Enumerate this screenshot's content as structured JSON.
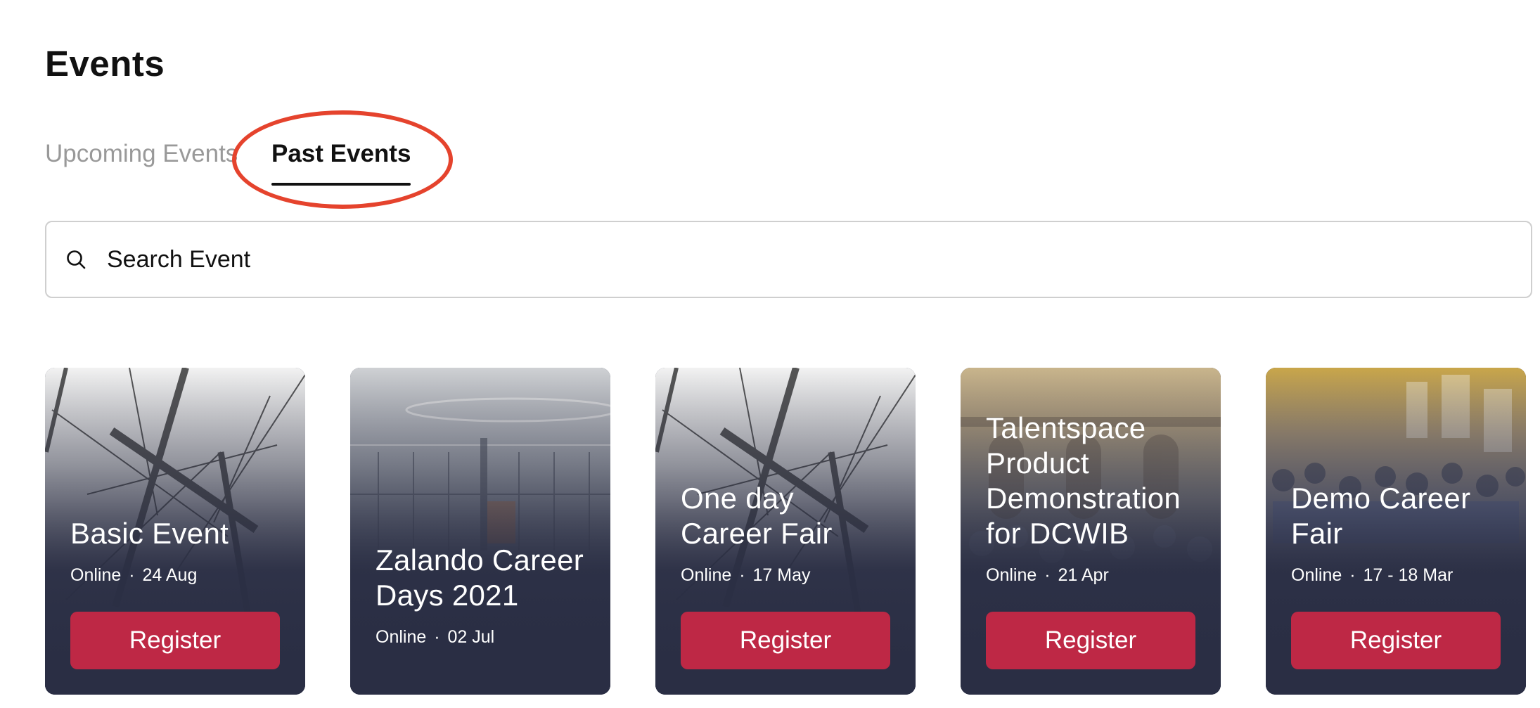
{
  "page": {
    "title": "Events"
  },
  "tabs": [
    {
      "label": "Upcoming Events",
      "active": false
    },
    {
      "label": "Past Events",
      "active": true
    }
  ],
  "search": {
    "placeholder": "Search Event",
    "value": ""
  },
  "events": [
    {
      "title": "Basic Event",
      "location": "Online",
      "date": "24 Aug",
      "button": "Register"
    },
    {
      "title": "Zalando Career Days 2021",
      "location": "Online",
      "date": "02 Jul",
      "button": ""
    },
    {
      "title": "One day Career Fair",
      "location": "Online",
      "date": "17 May",
      "button": "Register"
    },
    {
      "title": "Talentspace Product Demonstration for DCWIB",
      "location": "Online",
      "date": "21 Apr",
      "button": "Register"
    },
    {
      "title": "Demo Career Fair",
      "location": "Online",
      "date": "17 - 18 Mar",
      "button": "Register"
    }
  ],
  "meta_separator": "·",
  "colors": {
    "accent_button": "#be2845",
    "card_background": "#2a2e44",
    "highlight_annotation": "#e5432d",
    "inactive_tab": "#999999"
  }
}
